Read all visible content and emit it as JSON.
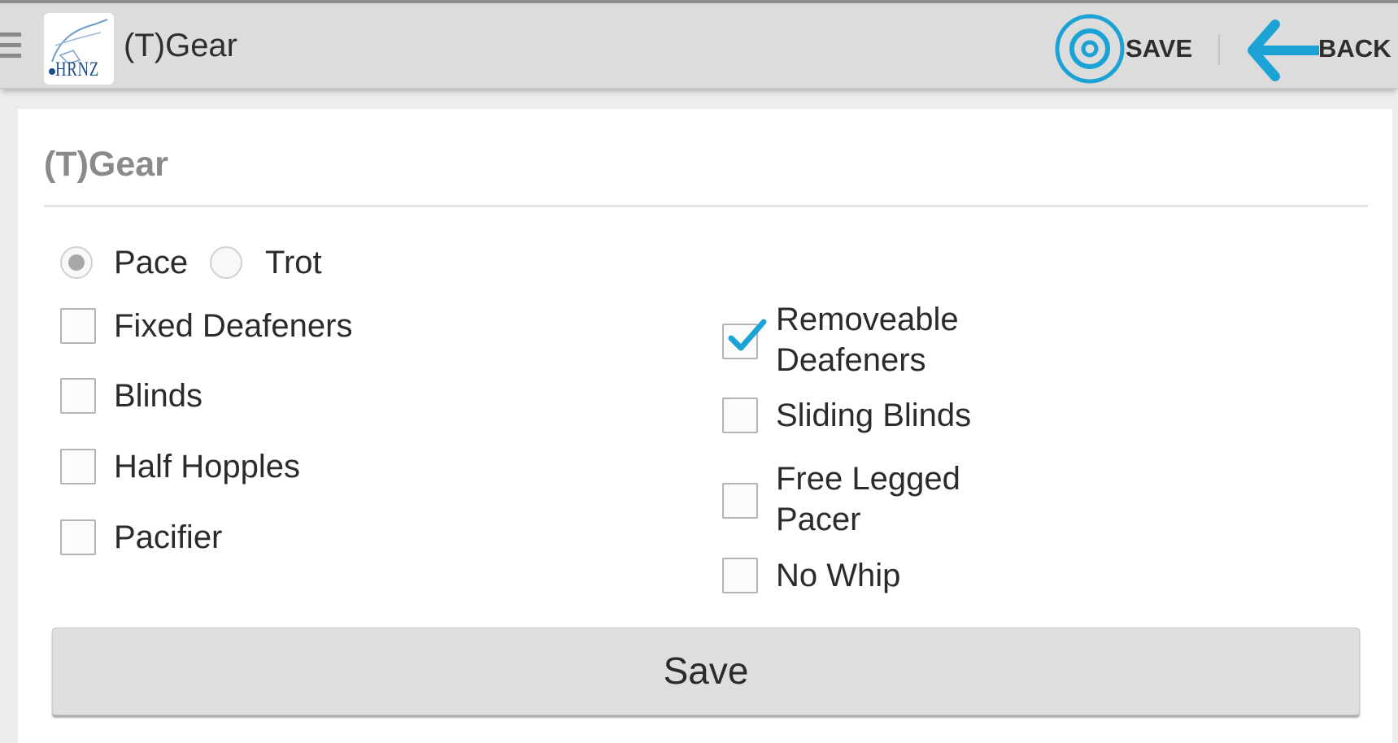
{
  "action_bar": {
    "title": "(T)Gear",
    "logo_text": "HRNZ",
    "save_label": "SAVE",
    "back_label": "BACK",
    "accent_color": "#1aa3d4"
  },
  "form": {
    "section_title": "(T)Gear",
    "gait": {
      "options": [
        {
          "label": "Pace",
          "selected": true
        },
        {
          "label": "Trot",
          "selected": false
        }
      ]
    },
    "left_options": [
      {
        "label": "Fixed Deafeners",
        "checked": false
      },
      {
        "label": "Blinds",
        "checked": false
      },
      {
        "label": "Half Hopples",
        "checked": false
      },
      {
        "label": "Pacifier",
        "checked": false
      }
    ],
    "right_options": [
      {
        "label": "Removeable Deafeners",
        "checked": true
      },
      {
        "label": "Sliding Blinds",
        "checked": false
      },
      {
        "label": "Free Legged Pacer",
        "checked": false
      },
      {
        "label": "No Whip",
        "checked": false
      }
    ],
    "save_button_label": "Save"
  }
}
